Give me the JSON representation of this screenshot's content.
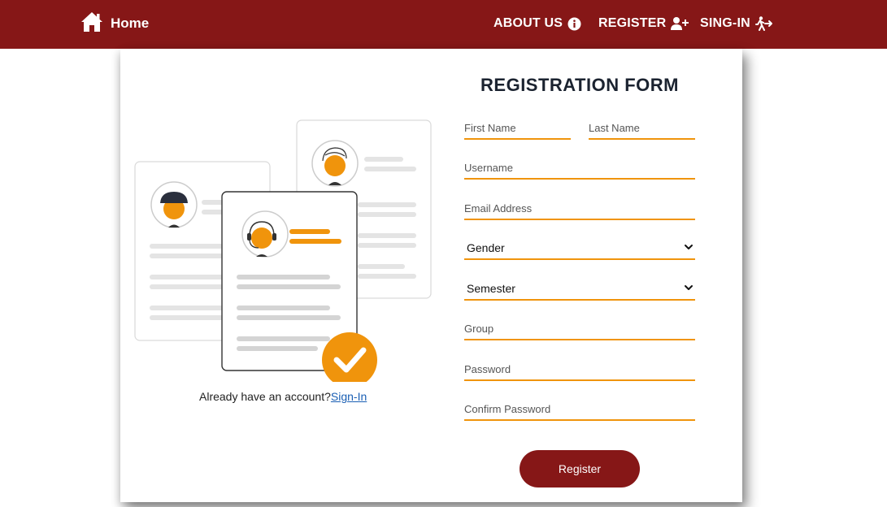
{
  "nav": {
    "home_label": "Home",
    "items": [
      {
        "label": "ABOUT US",
        "icon": "info-circle-icon"
      },
      {
        "label": "REGISTER",
        "icon": "user-plus-icon"
      },
      {
        "label": "SING-IN",
        "icon": "person-walking-arrow-icon"
      }
    ]
  },
  "colors": {
    "brand": "#861717",
    "accent": "#f0940c",
    "text_dark": "#1b2330",
    "link": "#1a5fb4"
  },
  "form": {
    "title": "REGISTRATION FORM",
    "fields": {
      "first_name": "First Name",
      "last_name": "Last Name",
      "username": "Username",
      "email": "Email Address",
      "gender": "Gender",
      "semester": "Semester",
      "group": "Group",
      "password": "Password",
      "confirm_password": "Confirm Password"
    },
    "submit_label": "Register"
  },
  "account": {
    "prompt": "Already have an account?",
    "link_label": "Sign-In"
  }
}
